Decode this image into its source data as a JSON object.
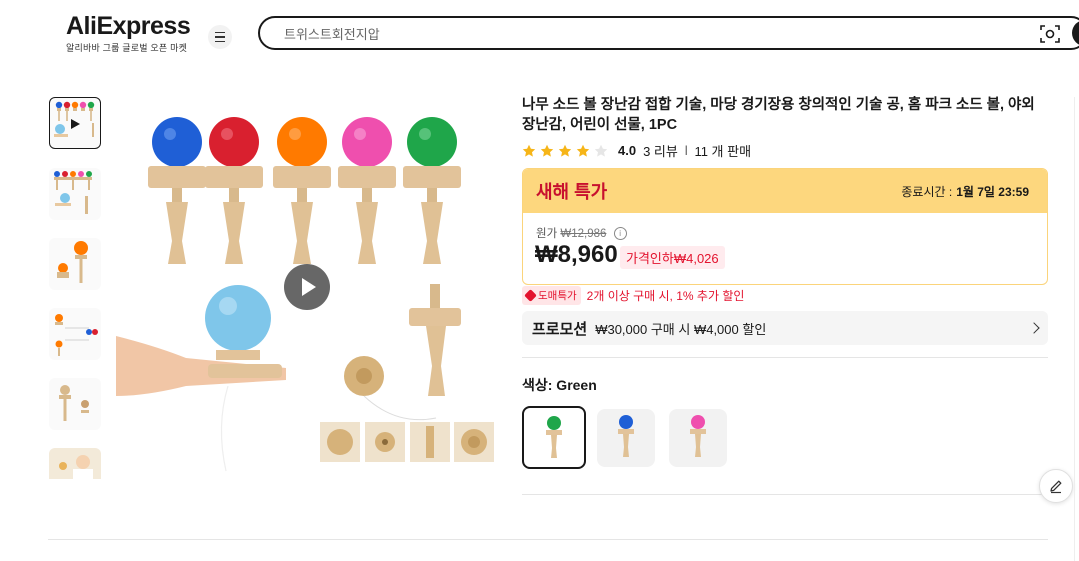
{
  "header": {
    "logo_text": "AliExpress",
    "logo_subtitle": "알리바바 그룹 글로벌 오픈 마켓",
    "search_placeholder": "트위스트회전지압",
    "menu_icon": "hamburger-icon",
    "camera_icon": "camera-search-icon"
  },
  "gallery": {
    "thumbnails": [
      "thumb-1",
      "thumb-2",
      "thumb-3",
      "thumb-4",
      "thumb-5",
      "thumb-6"
    ],
    "selected_index": 0
  },
  "product": {
    "title": "나무 소드 볼 장난감 접합 기술, 마당 경기장용 창의적인 기술 공, 홈 파크 소드 볼, 야외 장난감, 어린이 선물, 1PC",
    "rating": "4.0",
    "rating_stars": 4,
    "reviews": "3 리뷰",
    "sold": "11 개 판매"
  },
  "deal": {
    "title": "새해 특가",
    "end_label": "종료시간 :",
    "end_time": "1월 7일 23:59",
    "original_label": "원가",
    "original_price": "₩12,986",
    "price": "₩8,960",
    "discount": "가격인하₩4,026"
  },
  "wholesale": {
    "tag": "도매특가",
    "text": "2개 이상 구매 시, 1% 추가 할인"
  },
  "promotion": {
    "label": "프로모션",
    "text": "₩30,000 구매 시 ₩4,000 할인"
  },
  "color": {
    "label": "색상: Green",
    "options": [
      {
        "name": "Green",
        "color": "#1fa64a"
      },
      {
        "name": "Blue",
        "color": "#1f5fd6"
      },
      {
        "name": "Pink",
        "color": "#ef4fae"
      }
    ],
    "selected": "Green"
  },
  "colors": {
    "accent_red": "#e3132e",
    "deal_yellow": "#fdd77e"
  }
}
